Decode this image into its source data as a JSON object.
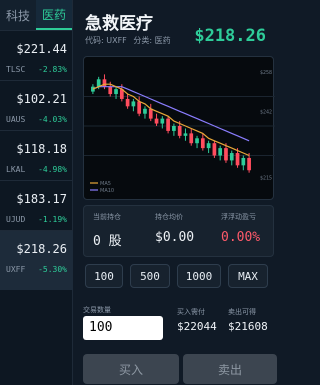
{
  "sidebar": {
    "tabs": [
      {
        "label": "科技",
        "active": false
      },
      {
        "label": "医药",
        "active": true
      }
    ],
    "stocks": [
      {
        "price": "$221.44",
        "symbol": "TLSC",
        "change": "-2.83%"
      },
      {
        "price": "$102.21",
        "symbol": "UAUS",
        "change": "-4.03%"
      },
      {
        "price": "$118.18",
        "symbol": "LKAL",
        "change": "-4.98%"
      },
      {
        "price": "$183.17",
        "symbol": "UJUD",
        "change": "-1.19%"
      },
      {
        "price": "$218.26",
        "symbol": "UXFF",
        "change": "-5.30%"
      }
    ]
  },
  "header": {
    "name": "急救医疗",
    "code_label": "代码: UXFF",
    "sector_label": "分类: 医药",
    "price": "$218.26"
  },
  "chart_data": {
    "type": "candlestick",
    "ytick_labels": [
      "$258",
      "$242",
      "$215"
    ],
    "legend": [
      "MA5",
      "MA10"
    ],
    "ma5_color": "#e8a838",
    "ma10_color": "#8a7dff",
    "up_color": "#2ecc99",
    "down_color": "#ff4d5e",
    "candles": [
      [
        250,
        253,
        249,
        252
      ],
      [
        252,
        256,
        251,
        255
      ],
      [
        255,
        257,
        251,
        252
      ],
      [
        252,
        254,
        248,
        249
      ],
      [
        249,
        252,
        247,
        251
      ],
      [
        251,
        253,
        246,
        247
      ],
      [
        247,
        249,
        243,
        244
      ],
      [
        244,
        247,
        242,
        246
      ],
      [
        246,
        248,
        240,
        241
      ],
      [
        241,
        244,
        239,
        243
      ],
      [
        243,
        245,
        238,
        239
      ],
      [
        239,
        241,
        236,
        237
      ],
      [
        237,
        240,
        235,
        239
      ],
      [
        239,
        240,
        233,
        234
      ],
      [
        234,
        237,
        232,
        236
      ],
      [
        236,
        238,
        231,
        232
      ],
      [
        232,
        235,
        230,
        233
      ],
      [
        233,
        235,
        228,
        229
      ],
      [
        229,
        232,
        227,
        231
      ],
      [
        231,
        233,
        226,
        227
      ],
      [
        227,
        230,
        225,
        229
      ],
      [
        229,
        230,
        223,
        224
      ],
      [
        224,
        228,
        222,
        227
      ],
      [
        227,
        229,
        221,
        222
      ],
      [
        222,
        226,
        220,
        225
      ],
      [
        225,
        227,
        219,
        220
      ],
      [
        220,
        224,
        218,
        223
      ],
      [
        223,
        225,
        217,
        218
      ]
    ],
    "ma5": [
      251,
      252,
      253,
      253,
      252,
      251,
      249,
      248,
      246,
      245,
      243,
      242,
      241,
      240,
      238,
      237,
      236,
      235,
      234,
      233,
      231,
      230,
      229,
      228,
      227,
      226,
      225,
      224
    ],
    "ma10": [
      251,
      252,
      252,
      252,
      252,
      252,
      251,
      250,
      249,
      248,
      247,
      246,
      245,
      244,
      243,
      242,
      241,
      240,
      239,
      238,
      237,
      236,
      235,
      234,
      233,
      232,
      231,
      230
    ]
  },
  "position": {
    "holding_label": "当前持仓",
    "holding_value": "0 股",
    "avg_cost_label": "持仓均价",
    "avg_cost_value": "$0.00",
    "pnl_label": "浮浮动盈亏",
    "pnl_value": "0.00%"
  },
  "quick_qty": [
    "100",
    "500",
    "1000",
    "MAX"
  ],
  "trade": {
    "qty_label": "交易数量",
    "qty_value": "100",
    "buy_need_label": "买入需付",
    "buy_need_value": "$22044",
    "sell_get_label": "卖出可得",
    "sell_get_value": "$21608",
    "buy_label": "买入",
    "sell_label": "卖出"
  }
}
